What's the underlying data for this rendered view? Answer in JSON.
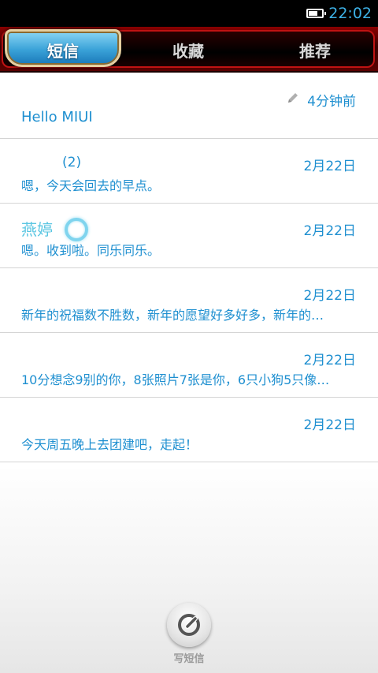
{
  "status_bar": {
    "time": "22:02",
    "battery_level": 0.7
  },
  "tabs": [
    {
      "label": "短信",
      "active": true
    },
    {
      "label": "收藏",
      "active": false
    },
    {
      "label": "推荐",
      "active": false
    }
  ],
  "conversations": [
    {
      "name": "",
      "time": "4分钟前",
      "preview": "Hello MIUI",
      "draft": true
    },
    {
      "name": "(2)",
      "time": "2月22日",
      "preview": "嗯，今天会回去的早点。"
    },
    {
      "name": "燕婷",
      "time": "2月22日",
      "preview": "嗯。收到啦。同乐同乐。"
    },
    {
      "name": "",
      "time": "2月22日",
      "preview": "新年的祝福数不胜数，新年的愿望好多好多，新年的…"
    },
    {
      "name": "",
      "time": "2月22日",
      "preview": "10分想念9别的你，8张照片7张是你，6只小狗5只像…"
    },
    {
      "name": "",
      "time": "2月22日",
      "preview": "今天周五晚上去团建吧，走起！"
    }
  ],
  "compose": {
    "label": "写短信",
    "icon": "compose-icon"
  },
  "colors": {
    "accent": "#1e8fd0",
    "tab_bar": "#8b0000",
    "active_tab": "#3aa2d8"
  }
}
